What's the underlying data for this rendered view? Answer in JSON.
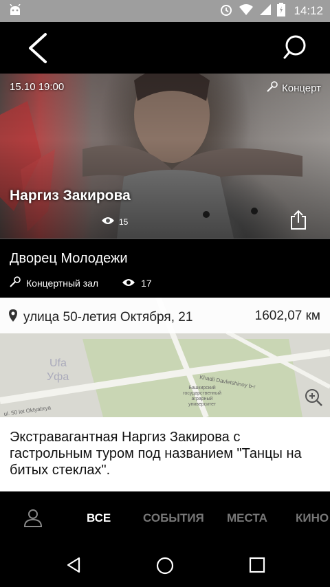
{
  "status_bar": {
    "time": "14:12",
    "icons": [
      "android-icon",
      "alarm-icon",
      "wifi-icon",
      "signal-icon",
      "battery-icon"
    ]
  },
  "app_bar": {
    "icons": [
      "back-icon",
      "search-icon"
    ]
  },
  "event": {
    "datetime": "15.10  19:00",
    "category": "Концерт",
    "title": "Наргиз Закирова",
    "views": "15"
  },
  "venue": {
    "name": "Дворец Молодежи",
    "type": "Концертный зал",
    "views": "17"
  },
  "map": {
    "address": "улица 50-летия Октября, 21",
    "distance": "1602,07  км",
    "labels": {
      "city_latin": "Ufa",
      "city": "Уфа",
      "street1": "Khadii Davletshinoy b-r",
      "street2": "ul. 50 let Oktyabrya",
      "university": "Башкирский государственный аграрный университет"
    }
  },
  "description": "Экстравагантная Наргиз Закирова с гастрольным туром под названием \"Танцы на битых стеклах\".",
  "tabs": {
    "all": "ВСЕ",
    "events": "СОБЫТИЯ",
    "places": "МЕСТА",
    "cinema": "КИНО"
  },
  "colors": {
    "status_bar": "#9e9e9e",
    "background": "#000000",
    "accent_red": "#b24b4b"
  }
}
